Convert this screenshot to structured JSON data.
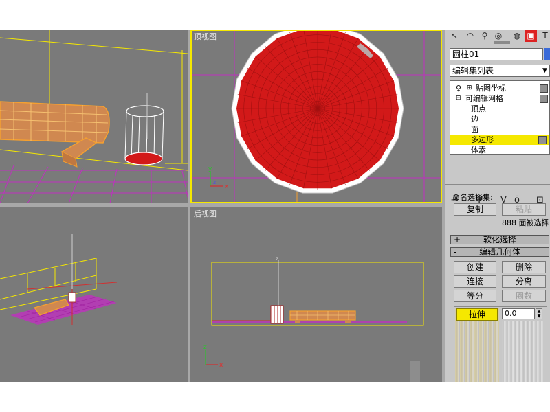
{
  "viewports": {
    "top": {
      "label": "顶视图"
    },
    "back": {
      "label": "后视图"
    }
  },
  "axes": {
    "x": "x",
    "y": "y",
    "z": "z"
  },
  "panel": {
    "object_name": "圆柱01",
    "modifier_list": "编辑集列表",
    "stack": {
      "uvw": "贴图坐标",
      "mesh": "可编辑网格",
      "vertex": "顶点",
      "edge": "边",
      "face": "面",
      "polygon": "多边形",
      "element": "体素"
    },
    "named_selection_label": "命名选择集:",
    "copy": "复制",
    "paste": "粘贴",
    "selection_info": "888 面被选择",
    "soft_selection": "软化选择",
    "edit_geometry": "编辑几何体",
    "create": "创建",
    "delete": "删除",
    "attach": "连接",
    "detach": "分离",
    "divide": "等分",
    "turn": "圈数",
    "extrude": "拉伸",
    "extrude_value": "0.0",
    "plus": "+",
    "minus": "-"
  },
  "colors": {
    "selected_poly": "#d21919",
    "wire_orange": "#f5a030",
    "grid_magenta": "#c030c0",
    "active_border": "#f5e800",
    "highlight": "#f5e800"
  }
}
